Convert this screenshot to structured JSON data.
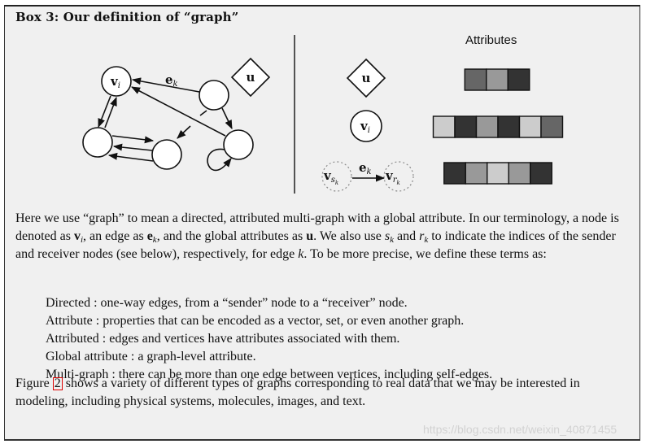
{
  "box": {
    "title": "Box 3: Our definition of “graph”"
  },
  "figure": {
    "graph_labels": {
      "node_vi": "v",
      "node_vi_sub": "i",
      "edge_ek": "e",
      "edge_ek_sub": "k",
      "global_u": "u"
    },
    "attributes_header": "Attributes",
    "legend_rows": [
      {
        "symbol": "diamond",
        "label": "u",
        "attribute_cells": [
          "#666666",
          "#999999",
          "#333333"
        ]
      },
      {
        "symbol": "circle",
        "label": "v",
        "label_sub": "i",
        "attribute_cells": [
          "#cccccc",
          "#333333",
          "#999999",
          "#333333",
          "#cccccc",
          "#666666"
        ]
      },
      {
        "symbol": "edge",
        "sender": "v",
        "sender_sub": "s",
        "sender_subsub": "k",
        "edge_label": "e",
        "edge_sub": "k",
        "receiver": "v",
        "receiver_sub": "r",
        "receiver_subsub": "k",
        "attribute_cells": [
          "#333333",
          "#999999",
          "#cccccc",
          "#999999",
          "#333333"
        ]
      }
    ]
  },
  "paragraph1": {
    "text_a": "Here we use “graph” to mean a directed, attributed multi-graph with a global attribute. In our terminology, a node is denoted as ",
    "vi": "v",
    "vi_sub": "i",
    "text_b": ", an edge as ",
    "ek": "e",
    "ek_sub": "k",
    "text_c": ", and the global attributes as ",
    "u": "u",
    "text_d": ". We also use ",
    "sk": "s",
    "sk_sub": "k",
    "text_e": " and ",
    "rk": "r",
    "rk_sub": "k",
    "text_f": " to indicate the indices of the sender and receiver nodes (see below), respectively, for edge ",
    "k": "k",
    "text_g": ". To be more precise, we define these terms as:"
  },
  "definitions": [
    {
      "term": "Directed",
      "sep": " : ",
      "definition": "one-way edges, from a “sender” node to a “receiver” node."
    },
    {
      "term": "Attribute",
      "sep": " : ",
      "definition": "properties that can be encoded as a vector, set, or even another graph."
    },
    {
      "term": "Attributed",
      "sep": " : ",
      "definition": "edges and vertices have attributes associated with them."
    },
    {
      "term": "Global attribute",
      "sep": " : ",
      "definition": "a graph-level attribute."
    },
    {
      "term": "Multi-graph",
      "sep": " : ",
      "definition": "there can be more than one edge between vertices, including self-edges."
    }
  ],
  "paragraph2": {
    "text_a": "Figure ",
    "figure_ref": "2",
    "text_b": " shows a variety of different types of graphs corresponding to real data that we may be interested in modeling, including physical systems, molecules, images, and text."
  },
  "watermark": "https://blog.csdn.net/weixin_40871455",
  "colors": {
    "box_background": "#f0f0f0",
    "figure_ref_border": "#dd0000"
  }
}
